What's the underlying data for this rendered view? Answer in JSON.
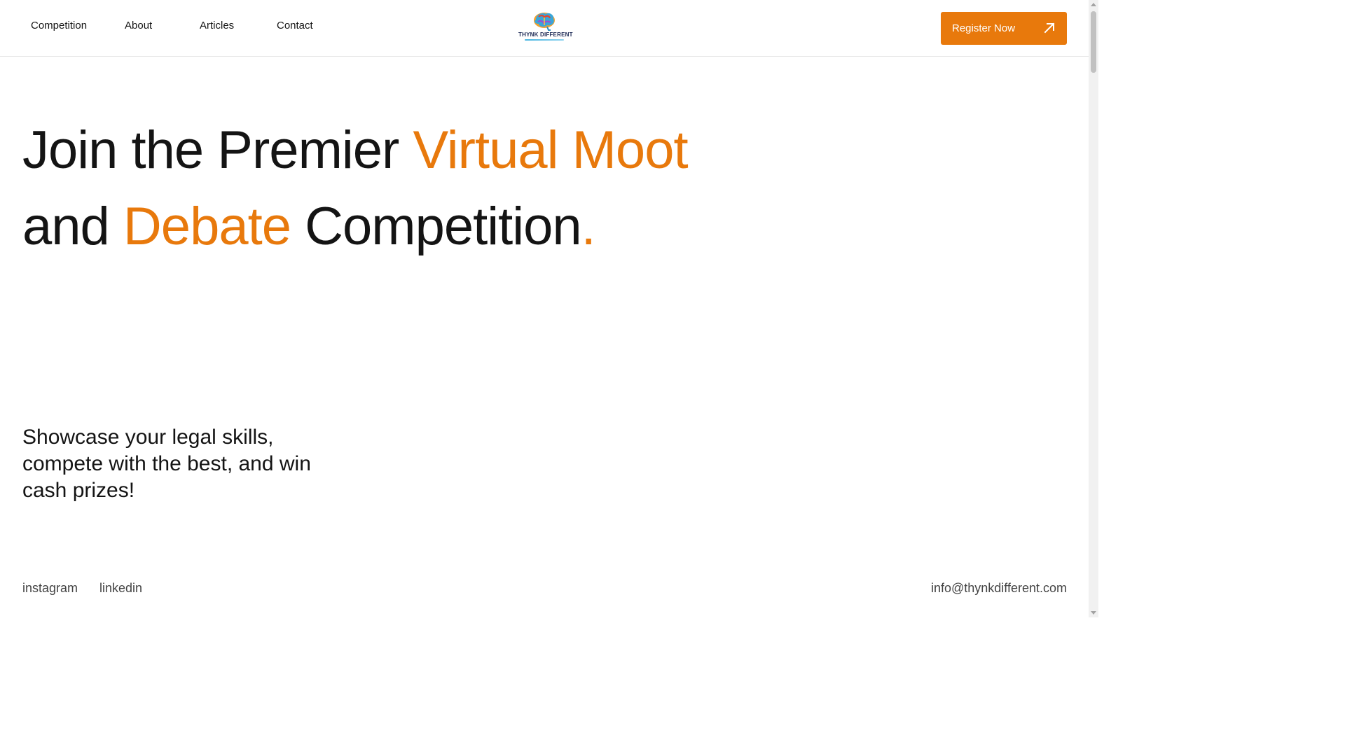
{
  "header": {
    "nav": [
      {
        "label": "Competition"
      },
      {
        "label": "About"
      },
      {
        "label": "Articles"
      },
      {
        "label": "Contact"
      }
    ],
    "logo": {
      "text": "THYNK DIFFERENT",
      "icon": "brain-logo-icon"
    },
    "register_button": {
      "label": "Register Now",
      "icon": "arrow-up-right-icon"
    }
  },
  "hero": {
    "line1_part1": "Join the Premier ",
    "line1_accent": "Virtual Moot",
    "line2_part1": "and ",
    "line2_accent": "Debate",
    "line2_part2": " Competition",
    "line2_period": ".",
    "tagline": "Showcase your legal skills, compete with the best, and win cash prizes!"
  },
  "footer": {
    "socials": [
      {
        "label": "instagram"
      },
      {
        "label": "linkedin"
      }
    ],
    "email": "info@thynkdifferent.com"
  },
  "colors": {
    "accent": "#e8790c",
    "text": "#141414"
  }
}
